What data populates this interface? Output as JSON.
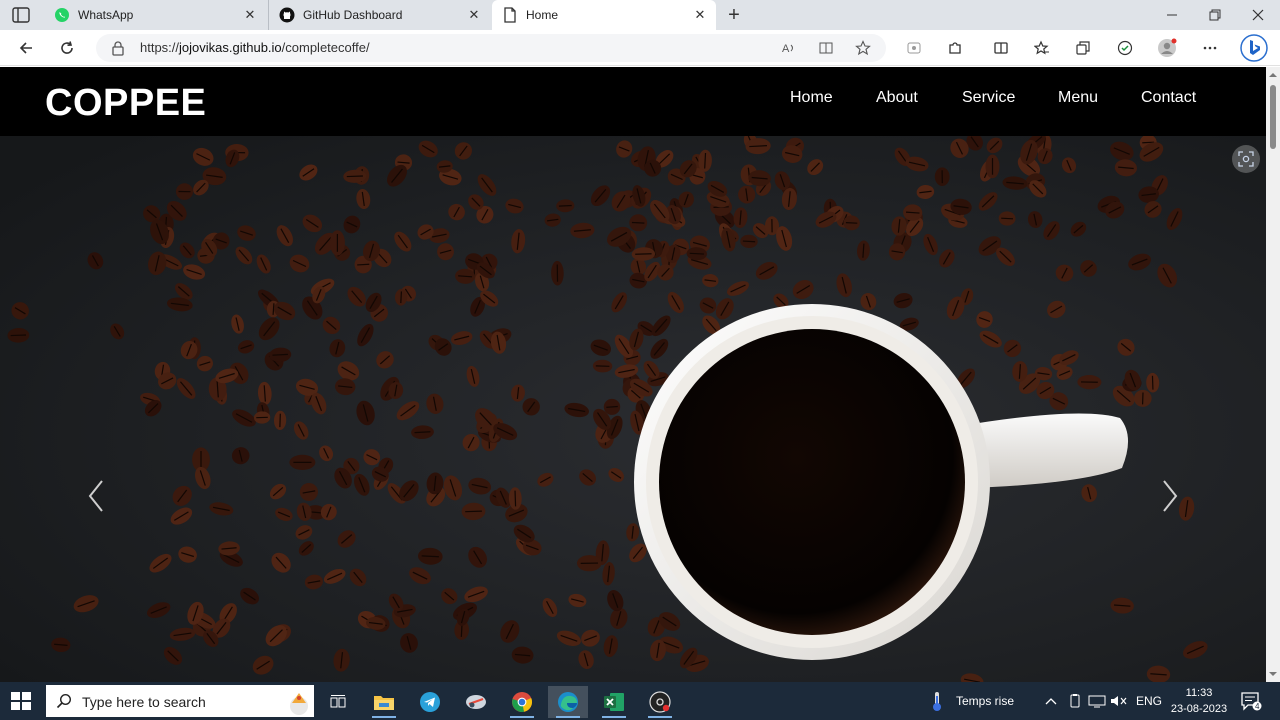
{
  "browser": {
    "tabs": [
      {
        "label": "WhatsApp",
        "icon": "whatsapp-icon"
      },
      {
        "label": "GitHub Dashboard",
        "icon": "github-icon"
      },
      {
        "label": "Home",
        "icon": "page-icon"
      }
    ],
    "address": {
      "scheme": "https://",
      "host": "jojovikas.github.io",
      "path": "/completecoffe/"
    }
  },
  "site": {
    "logo": "COPPEE",
    "nav": [
      "Home",
      "About",
      "Service",
      "Menu",
      "Contact"
    ]
  },
  "taskbar": {
    "search_placeholder": "Type here to search",
    "weather": "Temps rise",
    "language": "ENG",
    "time": "11:33",
    "date": "23-08-2023",
    "notifications": "4"
  },
  "colors": {
    "navbar": "#000000",
    "taskbar": "#1c2a3a",
    "excel": "#1d6f42",
    "telegram": "#2aa1da"
  }
}
